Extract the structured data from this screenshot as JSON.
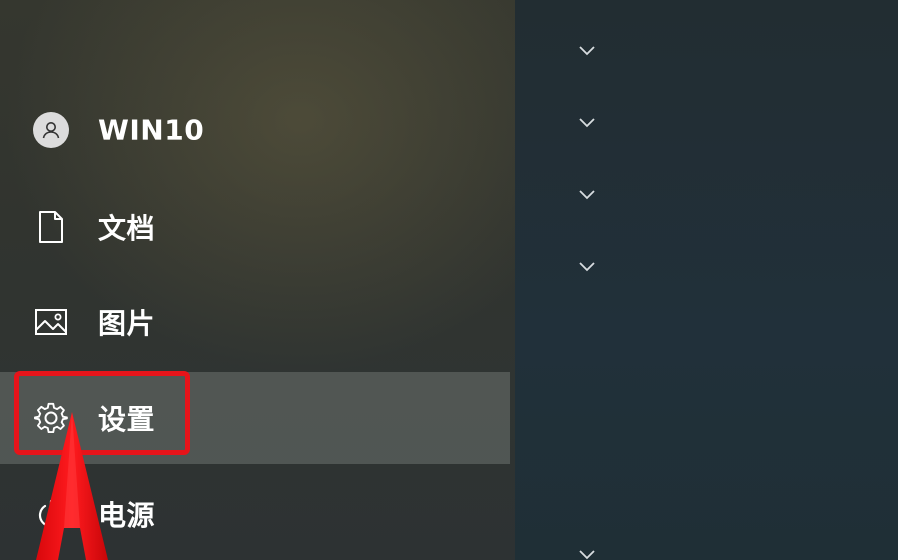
{
  "start_menu": {
    "items": [
      {
        "id": "user",
        "label": "WIN10",
        "icon": "user-avatar-icon"
      },
      {
        "id": "documents",
        "label": "文档",
        "icon": "document-icon"
      },
      {
        "id": "pictures",
        "label": "图片",
        "icon": "picture-icon"
      },
      {
        "id": "settings",
        "label": "设置",
        "icon": "gear-icon",
        "selected": true
      },
      {
        "id": "power",
        "label": "电源",
        "icon": "power-icon"
      }
    ]
  },
  "tile_groups": {
    "expand_icons": [
      "chevron-down-icon",
      "chevron-down-icon",
      "chevron-down-icon",
      "chevron-down-icon",
      "chevron-down-icon"
    ]
  },
  "annotation": {
    "highlight_color": "#e6141a",
    "target": "settings"
  },
  "colors": {
    "menu_background": "#31342f",
    "tiles_background": "#21303a",
    "selected_item": "#5c605f",
    "text": "#ffffff"
  }
}
